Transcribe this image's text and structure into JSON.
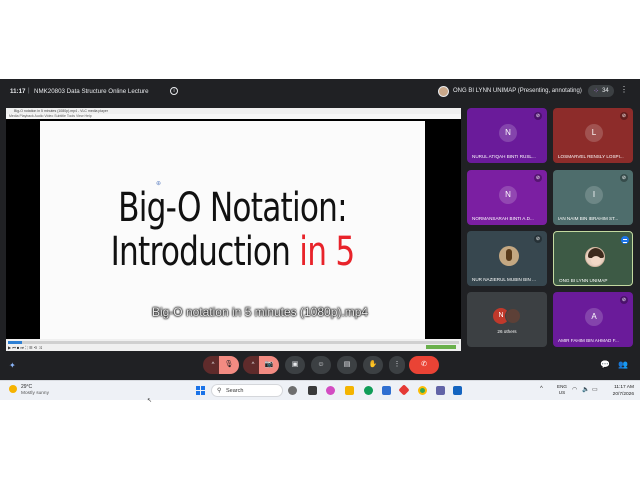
{
  "meet": {
    "time": "11:17",
    "separator": "|",
    "title": "NMK20803 Data Structure Online Lecture",
    "presenter": "ONG BI LYNN UNIMAP (Presenting, annotating)",
    "participant_count": "34"
  },
  "player": {
    "window_title": "Big-O notation in 5 minutes (1080p).mp4 - VLC media player",
    "menu": "Media   Playback   Audio   Video   Subtitle   Tools   View   Help",
    "slide_line1": "Big-O Notation:",
    "slide_line2_a": "Introduction ",
    "slide_line2_b": "in 5",
    "caption": "Big-O notation in 5 minutes (1080p).mp4",
    "controls": "▶ ⏮ ■ ⏭  ⛶ ☰ ⟲ ⤨",
    "progress": 0.03
  },
  "participants": [
    {
      "initial": "N",
      "name": "NURUL ATIQAH BINTI RUSL...",
      "color": "#6a1b9a"
    },
    {
      "initial": "L",
      "name": "LOSMARVEL RENSLY LOSPI...",
      "color": "#8d2c2a"
    },
    {
      "initial": "N",
      "name": "NORMANSARAH BINTI A.D...",
      "color": "#7b1fa2"
    },
    {
      "initial": "I",
      "name": "IAN NAIM BIN IBRAHIM ST...",
      "color": "#4e6d6c"
    },
    {
      "initial": "",
      "name": "NUR NAZIERUL MUBIN BIN ...",
      "color": "#37474f"
    },
    {
      "initial": "",
      "name": "ONG BI LYNN UNIMAP",
      "color": "#3d5a45"
    },
    {
      "initial": "N",
      "name": "26 others",
      "color": "#3c4043"
    },
    {
      "initial": "A",
      "name": "AMIR FAHIM BIN AHMAD F...",
      "color": "#6a1b9a"
    }
  ],
  "controls": {
    "caret": "^",
    "mic_off": "🎙",
    "cam_off": "📷",
    "present": "▣",
    "emoji": "☺",
    "captions": "▤",
    "raise_hand": "✋",
    "more": "⋮",
    "leave": "✆",
    "sparkle": "✦",
    "chat": "💬",
    "people": "👥"
  },
  "taskbar": {
    "temp": "29°C",
    "weather": "Mostly sunny",
    "search": "Search",
    "lang1": "ENG",
    "lang2": "US",
    "time": "11:17 AM",
    "date": "20/7/2026",
    "tray_up": "^",
    "wifi": "◠",
    "sound": "🔈",
    "battery": "▭"
  },
  "colors": {
    "meet_bg": "#202124",
    "leave_red": "#ea4335",
    "accent_blue": "#1a73e8"
  }
}
